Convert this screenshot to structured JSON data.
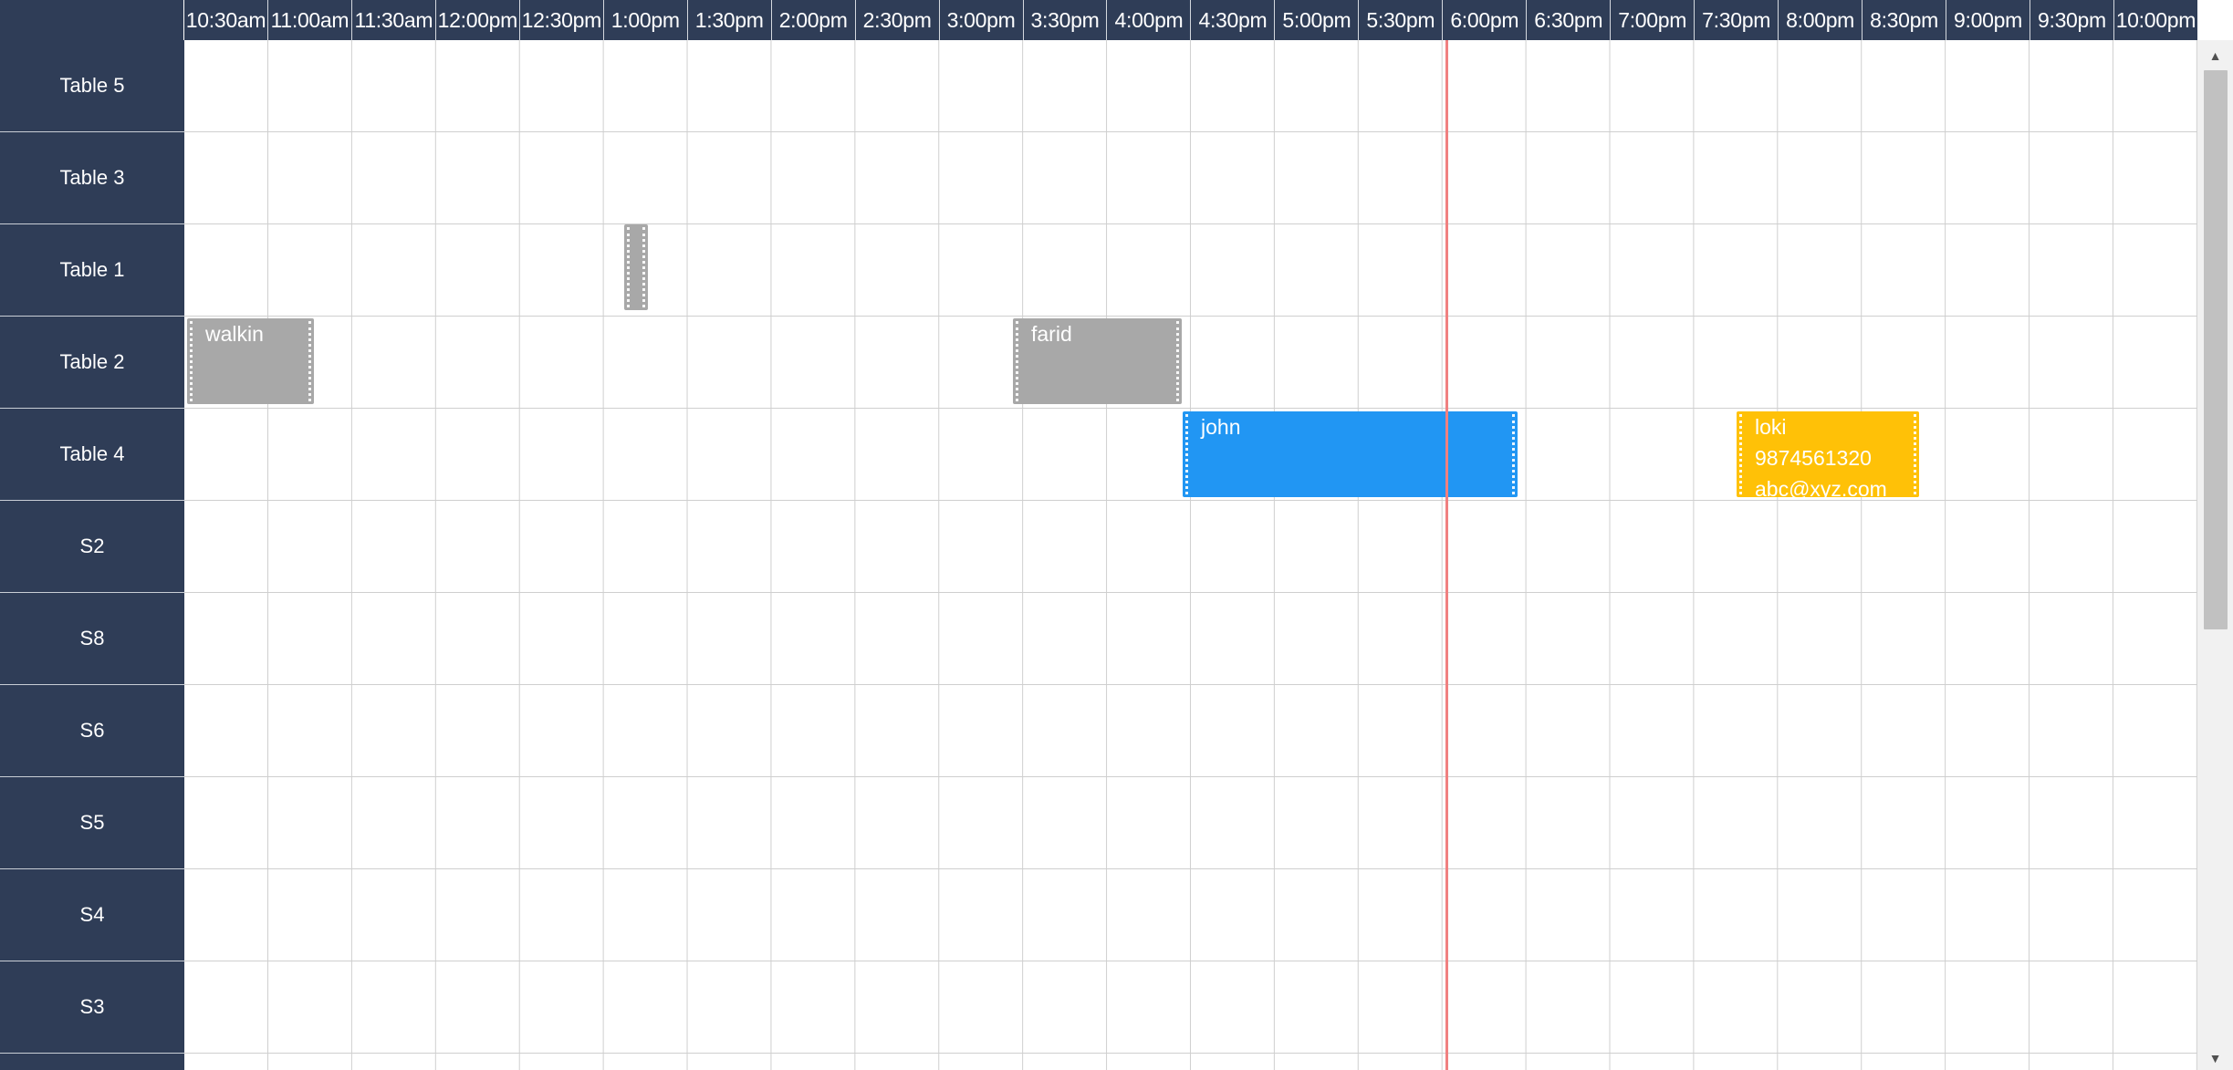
{
  "time_slots": [
    "10:30am",
    "11:00am",
    "11:30am",
    "12:00pm",
    "12:30pm",
    "1:00pm",
    "1:30pm",
    "2:00pm",
    "2:30pm",
    "3:00pm",
    "3:30pm",
    "4:00pm",
    "4:30pm",
    "5:00pm",
    "5:30pm",
    "6:00pm",
    "6:30pm",
    "7:00pm",
    "7:30pm",
    "8:00pm",
    "8:30pm",
    "9:00pm",
    "9:30pm",
    "10:00pm"
  ],
  "rows": [
    "Table 5",
    "Table 3",
    "Table 1",
    "Table 2",
    "Table 4",
    "S2",
    "S8",
    "S6",
    "S5",
    "S4",
    "S3"
  ],
  "bookings": [
    {
      "id": "b-empty",
      "row": "Table 1",
      "lines": []
    },
    {
      "id": "b-walkin",
      "row": "Table 2",
      "lines": [
        "walkin"
      ]
    },
    {
      "id": "b-farid",
      "row": "Table 2",
      "lines": [
        "farid"
      ]
    },
    {
      "id": "b-john",
      "row": "Table 4",
      "lines": [
        "john"
      ]
    },
    {
      "id": "b-loki",
      "row": "Table 4",
      "lines": [
        "loki",
        "9874561320",
        "abc@xyz.com"
      ]
    }
  ],
  "colors": {
    "header_bg": "#2f3d57",
    "booking_grey": "#a8a8a8",
    "booking_blue": "#2196f3",
    "booking_yellow": "#ffc107",
    "current_time_line": "#f08080"
  },
  "icons": {
    "scroll_up": "triangle-up",
    "scroll_down": "triangle-down"
  }
}
